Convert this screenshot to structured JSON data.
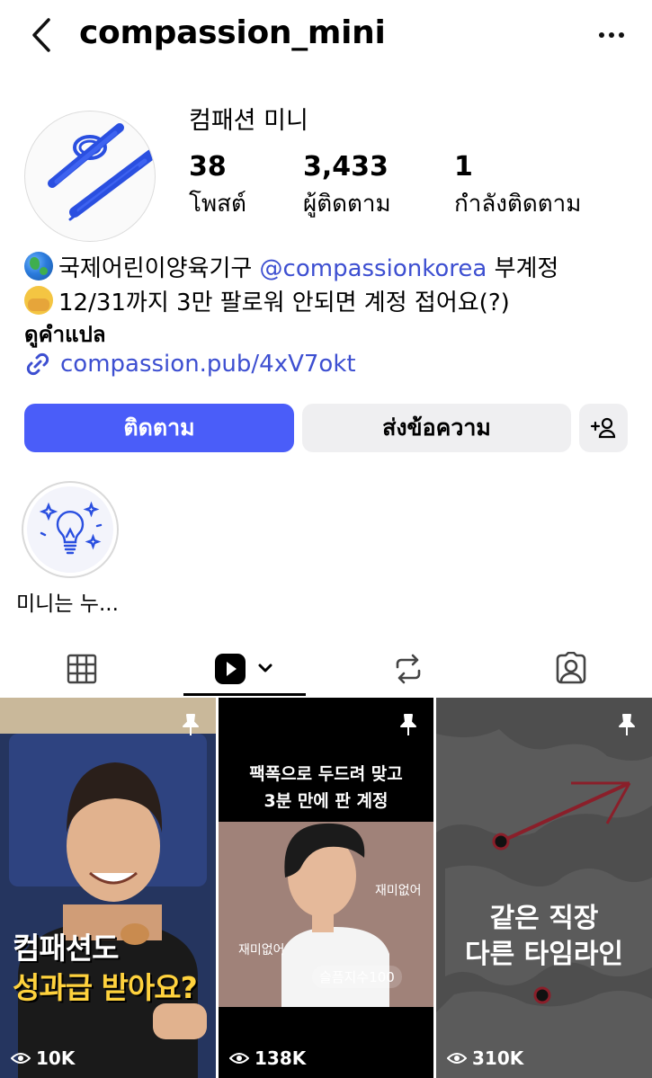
{
  "header": {
    "handle": "compassion_mini"
  },
  "profile": {
    "display_name": "컴패션 미니",
    "stats": [
      {
        "value": "38",
        "label": "โพสต์"
      },
      {
        "value": "3,433",
        "label": "ผู้ติดตาม"
      },
      {
        "value": "1",
        "label": "กำลังติดตาม"
      }
    ],
    "bio": {
      "line1_text": "국제어린이양육기구",
      "line1_mention": "@compassionkorea",
      "line1_suffix": "부계정",
      "line2_text": "12/31까지 3만 팔로워 안되면 계정 접어요(?)"
    },
    "translate_label": "ดูคำแปล",
    "link": "compassion.pub/4xV7okt"
  },
  "actions": {
    "follow_label": "ติดตาม",
    "message_label": "ส่งข้อความ"
  },
  "highlight": {
    "label": "미니는 누..."
  },
  "tabs": [
    "grid-tab",
    "reels-tab",
    "reposts-tab",
    "tagged-tab"
  ],
  "reels": [
    {
      "views": "10K",
      "caption_top": "컴패션도",
      "caption_bottom": "성과급 받아요?"
    },
    {
      "views": "138K",
      "headline_1": "팩폭으로 두드려 맞고",
      "headline_2": "3분 만에 판 계정",
      "bubble_1": "재미없어",
      "bubble_2": "재미없어",
      "bubble_3": "슬픔지수100"
    },
    {
      "views": "310K",
      "caption_1": "같은 직장",
      "caption_2": "다른 타임라인"
    }
  ],
  "colors": {
    "accent": "#4a5df9",
    "link": "#3d4fd1",
    "button_gray": "#efeff1"
  }
}
